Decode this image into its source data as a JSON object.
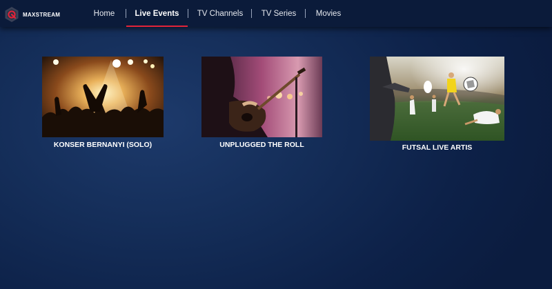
{
  "brand": {
    "logo_text": "MAXSTREAM",
    "accent_color": "#e3233a"
  },
  "nav": {
    "items": [
      {
        "label": "Home",
        "active": false
      },
      {
        "label": "Live Events",
        "active": true
      },
      {
        "label": "TV Channels",
        "active": false
      },
      {
        "label": "TV Series",
        "active": false
      },
      {
        "label": "Movies",
        "active": false
      }
    ]
  },
  "events": [
    {
      "title": "KONSER BERNANYI (SOLO)",
      "image": "concert-crowd-heart-hands"
    },
    {
      "title": "UNPLUGGED THE ROLL",
      "image": "acoustic-guitar-player-on-stage"
    },
    {
      "title": "FUTSAL LIVE ARTIS",
      "image": "football-players-in-stadium"
    }
  ]
}
